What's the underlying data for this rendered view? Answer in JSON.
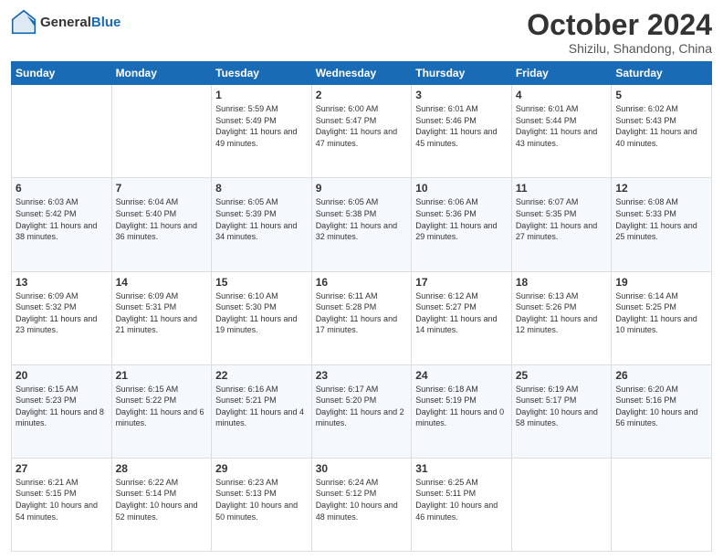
{
  "header": {
    "logo": {
      "general": "General",
      "blue": "Blue"
    },
    "title": "October 2024",
    "location": "Shizilu, Shandong, China"
  },
  "days_of_week": [
    "Sunday",
    "Monday",
    "Tuesday",
    "Wednesday",
    "Thursday",
    "Friday",
    "Saturday"
  ],
  "weeks": [
    [
      {
        "day": null,
        "sunrise": null,
        "sunset": null,
        "daylight": null
      },
      {
        "day": null,
        "sunrise": null,
        "sunset": null,
        "daylight": null
      },
      {
        "day": "1",
        "sunrise": "Sunrise: 5:59 AM",
        "sunset": "Sunset: 5:49 PM",
        "daylight": "Daylight: 11 hours and 49 minutes."
      },
      {
        "day": "2",
        "sunrise": "Sunrise: 6:00 AM",
        "sunset": "Sunset: 5:47 PM",
        "daylight": "Daylight: 11 hours and 47 minutes."
      },
      {
        "day": "3",
        "sunrise": "Sunrise: 6:01 AM",
        "sunset": "Sunset: 5:46 PM",
        "daylight": "Daylight: 11 hours and 45 minutes."
      },
      {
        "day": "4",
        "sunrise": "Sunrise: 6:01 AM",
        "sunset": "Sunset: 5:44 PM",
        "daylight": "Daylight: 11 hours and 43 minutes."
      },
      {
        "day": "5",
        "sunrise": "Sunrise: 6:02 AM",
        "sunset": "Sunset: 5:43 PM",
        "daylight": "Daylight: 11 hours and 40 minutes."
      }
    ],
    [
      {
        "day": "6",
        "sunrise": "Sunrise: 6:03 AM",
        "sunset": "Sunset: 5:42 PM",
        "daylight": "Daylight: 11 hours and 38 minutes."
      },
      {
        "day": "7",
        "sunrise": "Sunrise: 6:04 AM",
        "sunset": "Sunset: 5:40 PM",
        "daylight": "Daylight: 11 hours and 36 minutes."
      },
      {
        "day": "8",
        "sunrise": "Sunrise: 6:05 AM",
        "sunset": "Sunset: 5:39 PM",
        "daylight": "Daylight: 11 hours and 34 minutes."
      },
      {
        "day": "9",
        "sunrise": "Sunrise: 6:05 AM",
        "sunset": "Sunset: 5:38 PM",
        "daylight": "Daylight: 11 hours and 32 minutes."
      },
      {
        "day": "10",
        "sunrise": "Sunrise: 6:06 AM",
        "sunset": "Sunset: 5:36 PM",
        "daylight": "Daylight: 11 hours and 29 minutes."
      },
      {
        "day": "11",
        "sunrise": "Sunrise: 6:07 AM",
        "sunset": "Sunset: 5:35 PM",
        "daylight": "Daylight: 11 hours and 27 minutes."
      },
      {
        "day": "12",
        "sunrise": "Sunrise: 6:08 AM",
        "sunset": "Sunset: 5:33 PM",
        "daylight": "Daylight: 11 hours and 25 minutes."
      }
    ],
    [
      {
        "day": "13",
        "sunrise": "Sunrise: 6:09 AM",
        "sunset": "Sunset: 5:32 PM",
        "daylight": "Daylight: 11 hours and 23 minutes."
      },
      {
        "day": "14",
        "sunrise": "Sunrise: 6:09 AM",
        "sunset": "Sunset: 5:31 PM",
        "daylight": "Daylight: 11 hours and 21 minutes."
      },
      {
        "day": "15",
        "sunrise": "Sunrise: 6:10 AM",
        "sunset": "Sunset: 5:30 PM",
        "daylight": "Daylight: 11 hours and 19 minutes."
      },
      {
        "day": "16",
        "sunrise": "Sunrise: 6:11 AM",
        "sunset": "Sunset: 5:28 PM",
        "daylight": "Daylight: 11 hours and 17 minutes."
      },
      {
        "day": "17",
        "sunrise": "Sunrise: 6:12 AM",
        "sunset": "Sunset: 5:27 PM",
        "daylight": "Daylight: 11 hours and 14 minutes."
      },
      {
        "day": "18",
        "sunrise": "Sunrise: 6:13 AM",
        "sunset": "Sunset: 5:26 PM",
        "daylight": "Daylight: 11 hours and 12 minutes."
      },
      {
        "day": "19",
        "sunrise": "Sunrise: 6:14 AM",
        "sunset": "Sunset: 5:25 PM",
        "daylight": "Daylight: 11 hours and 10 minutes."
      }
    ],
    [
      {
        "day": "20",
        "sunrise": "Sunrise: 6:15 AM",
        "sunset": "Sunset: 5:23 PM",
        "daylight": "Daylight: 11 hours and 8 minutes."
      },
      {
        "day": "21",
        "sunrise": "Sunrise: 6:15 AM",
        "sunset": "Sunset: 5:22 PM",
        "daylight": "Daylight: 11 hours and 6 minutes."
      },
      {
        "day": "22",
        "sunrise": "Sunrise: 6:16 AM",
        "sunset": "Sunset: 5:21 PM",
        "daylight": "Daylight: 11 hours and 4 minutes."
      },
      {
        "day": "23",
        "sunrise": "Sunrise: 6:17 AM",
        "sunset": "Sunset: 5:20 PM",
        "daylight": "Daylight: 11 hours and 2 minutes."
      },
      {
        "day": "24",
        "sunrise": "Sunrise: 6:18 AM",
        "sunset": "Sunset: 5:19 PM",
        "daylight": "Daylight: 11 hours and 0 minutes."
      },
      {
        "day": "25",
        "sunrise": "Sunrise: 6:19 AM",
        "sunset": "Sunset: 5:17 PM",
        "daylight": "Daylight: 10 hours and 58 minutes."
      },
      {
        "day": "26",
        "sunrise": "Sunrise: 6:20 AM",
        "sunset": "Sunset: 5:16 PM",
        "daylight": "Daylight: 10 hours and 56 minutes."
      }
    ],
    [
      {
        "day": "27",
        "sunrise": "Sunrise: 6:21 AM",
        "sunset": "Sunset: 5:15 PM",
        "daylight": "Daylight: 10 hours and 54 minutes."
      },
      {
        "day": "28",
        "sunrise": "Sunrise: 6:22 AM",
        "sunset": "Sunset: 5:14 PM",
        "daylight": "Daylight: 10 hours and 52 minutes."
      },
      {
        "day": "29",
        "sunrise": "Sunrise: 6:23 AM",
        "sunset": "Sunset: 5:13 PM",
        "daylight": "Daylight: 10 hours and 50 minutes."
      },
      {
        "day": "30",
        "sunrise": "Sunrise: 6:24 AM",
        "sunset": "Sunset: 5:12 PM",
        "daylight": "Daylight: 10 hours and 48 minutes."
      },
      {
        "day": "31",
        "sunrise": "Sunrise: 6:25 AM",
        "sunset": "Sunset: 5:11 PM",
        "daylight": "Daylight: 10 hours and 46 minutes."
      },
      {
        "day": null,
        "sunrise": null,
        "sunset": null,
        "daylight": null
      },
      {
        "day": null,
        "sunrise": null,
        "sunset": null,
        "daylight": null
      }
    ]
  ]
}
